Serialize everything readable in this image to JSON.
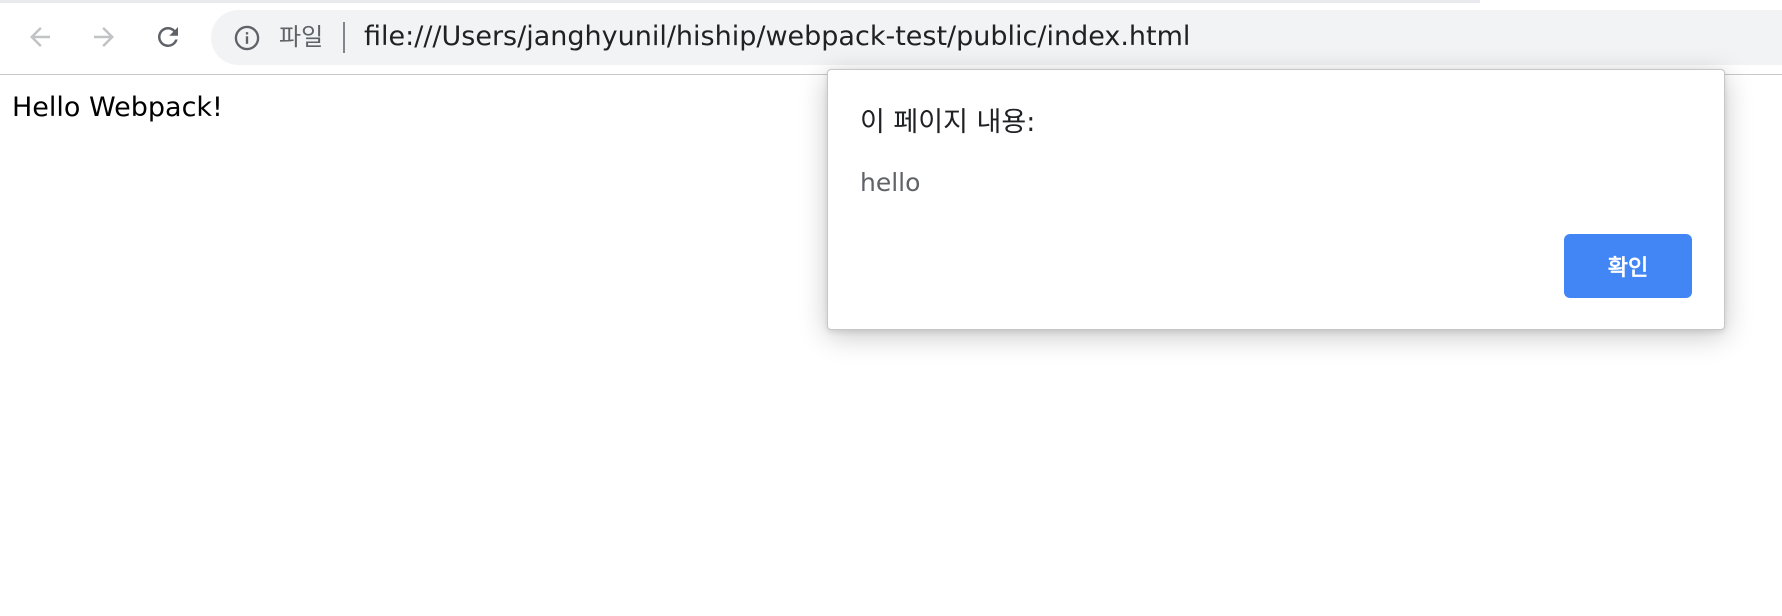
{
  "browser": {
    "nav": {
      "back_icon": "arrow-left-icon",
      "forward_icon": "arrow-right-icon",
      "reload_icon": "reload-icon"
    },
    "omnibox": {
      "info_icon": "info-icon",
      "scheme_label": "파일",
      "url": "file:///Users/janghyunil/hiship/webpack-test/public/index.html"
    }
  },
  "page": {
    "body_text": "Hello Webpack!"
  },
  "dialog": {
    "title": "이 페이지 내용:",
    "message": "hello",
    "ok_label": "확인"
  },
  "colors": {
    "accent": "#4285f4",
    "omnibox_bg": "#f1f3f4",
    "text_primary": "#202124",
    "text_secondary": "#5f6368"
  }
}
